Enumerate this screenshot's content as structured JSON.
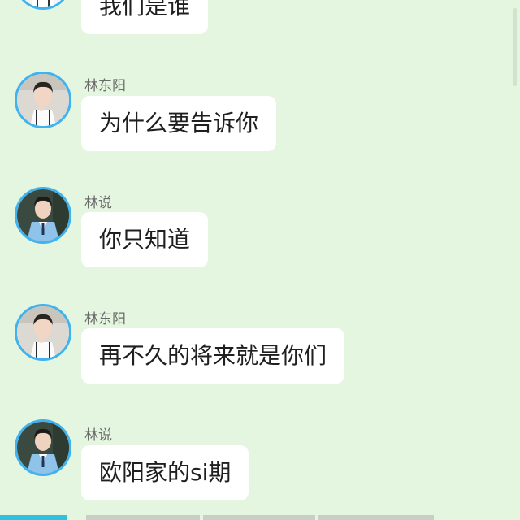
{
  "messages": [
    {
      "sender": "",
      "text": "我们是谁",
      "avatar": "boy-uniform-avatar"
    },
    {
      "sender": "林东阳",
      "text": "为什么要告诉你",
      "avatar": "boy-uniform-avatar"
    },
    {
      "sender": "林说",
      "text": "你只知道",
      "avatar": "boy-blue-sweater-avatar"
    },
    {
      "sender": "林东阳",
      "text": "再不久的将来就是你们",
      "avatar": "boy-uniform-avatar"
    },
    {
      "sender": "林说",
      "text": "欧阳家的si期",
      "avatar": "boy-blue-sweater-avatar"
    }
  ],
  "colors": {
    "background": "#e4f6df",
    "bubble": "#ffffff",
    "avatar_ring": "#3fb3f0",
    "accent": "#2fc2e0"
  }
}
